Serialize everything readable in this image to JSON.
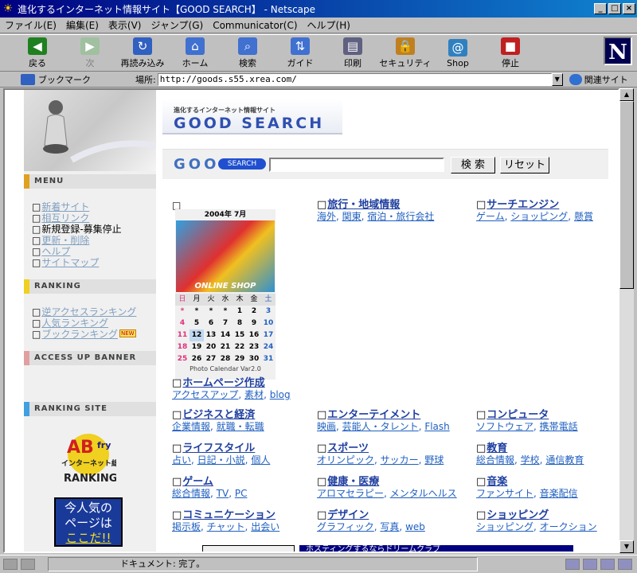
{
  "window": {
    "title": "進化するインターネット情報サイト【GOOD SEARCH】 - Netscape",
    "buttons": [
      "_",
      "□",
      "×"
    ]
  },
  "menubar": [
    "ファイル(E)",
    "編集(E)",
    "表示(V)",
    "ジャンプ(G)",
    "Communicator(C)",
    "ヘルプ(H)"
  ],
  "toolbar": [
    {
      "label": "戻る",
      "icon": "back-arrow-icon",
      "color": "#208020",
      "glyph": "◀",
      "disabled": false
    },
    {
      "label": "次",
      "icon": "forward-arrow-icon",
      "color": "#a0c0a0",
      "glyph": "▶",
      "disabled": true
    },
    {
      "label": "再読み込み",
      "icon": "reload-icon",
      "color": "#3060c0",
      "glyph": "↻",
      "disabled": false
    },
    {
      "label": "ホーム",
      "icon": "home-icon",
      "color": "#4070d0",
      "glyph": "⌂",
      "disabled": false
    },
    {
      "label": "検索",
      "icon": "search-icon",
      "color": "#4070d0",
      "glyph": "⌕",
      "disabled": false
    },
    {
      "label": "ガイド",
      "icon": "guide-icon",
      "color": "#4070d0",
      "glyph": "⇅",
      "disabled": false
    },
    {
      "label": "印刷",
      "icon": "print-icon",
      "color": "#606080",
      "glyph": "▤",
      "disabled": false
    },
    {
      "label": "セキュリティ",
      "icon": "security-lock-icon",
      "color": "#c08020",
      "glyph": "🔒",
      "disabled": false
    },
    {
      "label": "Shop",
      "icon": "shop-icon",
      "color": "#3080c0",
      "glyph": "@",
      "disabled": false
    },
    {
      "label": "停止",
      "icon": "stop-icon",
      "color": "#c02020",
      "glyph": "■",
      "disabled": false
    }
  ],
  "location": {
    "bookmarks": "ブックマーク",
    "label": "場所:",
    "url": "http://goods.s55.xrea.com/",
    "related": "関連サイト"
  },
  "status": {
    "text": "ドキュメント: 完了。"
  },
  "sidebar": {
    "menu_title": "MENU",
    "menu": [
      "新着サイト",
      "相互リンク",
      "新規登録-募集停止",
      "更新・削除",
      "ヘルプ",
      "サイトマップ"
    ],
    "ranking_title": "RANKING",
    "ranking": [
      "逆アクセスランキング",
      "人気ランキング",
      "ブックランキング"
    ],
    "ranking_new_badge": "NEW",
    "banner_title": "ACCESS UP BANNER",
    "ranksite_title": "RANKING SITE",
    "rank_logo": {
      "top": "AB",
      "fry": "fry",
      "line1": "インターネット総合",
      "line2": "RANKING"
    },
    "popular": [
      "今人気の",
      "ページは",
      "ここだ!!"
    ]
  },
  "header": {
    "subtitle": "進化するインターネット情報サイト",
    "title": "GOOD SEARCH"
  },
  "search": {
    "logo": "GOO",
    "badge": "SEARCH",
    "submit": "検 索",
    "reset": "リセット"
  },
  "calendar": {
    "title": "2004年 7月",
    "photo_text": "ONLINE SHOP",
    "weekdays": [
      "日",
      "月",
      "火",
      "水",
      "木",
      "金",
      "土"
    ],
    "days": [
      "*",
      "*",
      "*",
      "*",
      "1",
      "2",
      "3",
      "4",
      "5",
      "6",
      "7",
      "8",
      "9",
      "10",
      "11",
      "12",
      "13",
      "14",
      "15",
      "16",
      "17",
      "18",
      "19",
      "20",
      "21",
      "22",
      "23",
      "24",
      "25",
      "26",
      "27",
      "28",
      "29",
      "30",
      "31"
    ],
    "footer": "Photo Calendar Var2.0"
  },
  "categories": [
    {
      "title": "旅行・地域情報",
      "subs": [
        "海外",
        "関東",
        "宿泊・旅行会社"
      ]
    },
    {
      "title": "サーチエンジン",
      "subs": [
        "ゲーム",
        "ショッピング",
        "懸賞"
      ]
    },
    {
      "title": "ホームページ作成",
      "subs": [
        "アクセスアップ",
        "素材",
        "blog"
      ]
    },
    {
      "title": "ビジネスと経済",
      "subs": [
        "企業情報",
        "就職・転職"
      ]
    },
    {
      "title": "エンターテイメント",
      "subs": [
        "映画",
        "芸能人・タレント",
        "Flash"
      ]
    },
    {
      "title": "コンピュータ",
      "subs": [
        "ソフトウェア",
        "携帯電話"
      ]
    },
    {
      "title": "ライフスタイル",
      "subs": [
        "占い",
        "日記・小説",
        "個人"
      ]
    },
    {
      "title": "スポーツ",
      "subs": [
        "オリンピック",
        "サッカー",
        "野球"
      ]
    },
    {
      "title": "教育",
      "subs": [
        "総合情報",
        "学校",
        "通信教育"
      ]
    },
    {
      "title": "ゲーム",
      "subs": [
        "総合情報",
        "TV",
        "PC"
      ]
    },
    {
      "title": "健康・医療",
      "subs": [
        "アロマセラピー",
        "メンタルヘルス"
      ]
    },
    {
      "title": "音楽",
      "subs": [
        "ファンサイト",
        "音楽配信"
      ]
    },
    {
      "title": "コミュニケーション",
      "subs": [
        "掲示板",
        "チャット",
        "出会い"
      ]
    },
    {
      "title": "デザイン",
      "subs": [
        "グラフィック",
        "写真",
        "web"
      ]
    },
    {
      "title": "ショッピング",
      "subs": [
        "ショッピング",
        "オークション"
      ]
    }
  ],
  "popup_strip": "ホスティングするならドリームクラブ"
}
